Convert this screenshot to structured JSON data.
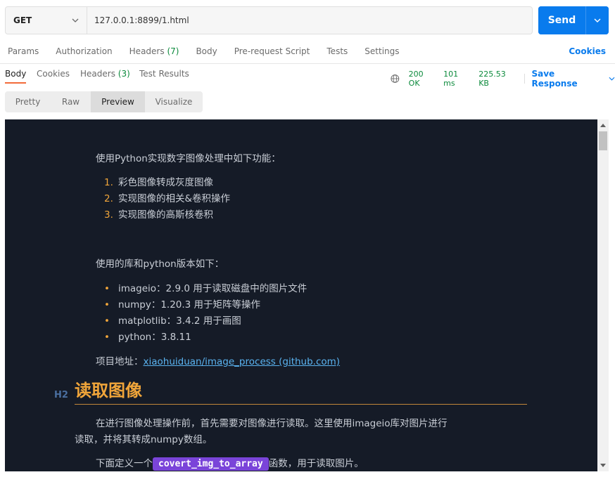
{
  "request": {
    "method": "GET",
    "url": "127.0.0.1:8899/1.html",
    "send_label": "Send"
  },
  "request_tabs": {
    "params": "Params",
    "authorization": "Authorization",
    "headers": "Headers",
    "headers_count": "(7)",
    "body": "Body",
    "prerequest": "Pre-request Script",
    "tests": "Tests",
    "settings": "Settings",
    "cookies": "Cookies"
  },
  "response_tabs": {
    "body": "Body",
    "cookies": "Cookies",
    "headers": "Headers",
    "headers_count": "(3)",
    "test_results": "Test Results"
  },
  "response_meta": {
    "status": "200 OK",
    "time": "101 ms",
    "size": "225.53 KB",
    "save_label": "Save Response"
  },
  "views": [
    "Pretty",
    "Raw",
    "Preview",
    "Visualize"
  ],
  "preview": {
    "intro": "使用Python实现数字图像处理中如下功能：",
    "features": [
      "彩色图像转成灰度图像",
      "实现图像的相关&卷积操作",
      "实现图像的高斯核卷积"
    ],
    "libs_intro": "使用的库和python版本如下：",
    "libs": [
      "imageio：2.9.0 用于读取磁盘中的图片文件",
      "numpy：1.20.3 用于矩阵等操作",
      "matplotlib：3.4.2 用于画图",
      "python：3.8.11"
    ],
    "project_label": "项目地址：",
    "project_link": "xiaohuiduan/image_process (github.com)",
    "h2_tag": "H2",
    "h2_title": "读取图像",
    "para1_line1": "在进行图像处理操作前，首先需要对图像进行读取。这里使用imageio库对图片进行",
    "para1_line2": "读取，并将其转成numpy数组。",
    "para2_before": "下面定义一个",
    "para2_code": "covert_img_to_array",
    "para2_after": "函数，用于读取图片。"
  },
  "colors": {
    "accent_blue": "#097bed",
    "status_green": "#0c8a3c",
    "preview_bg": "#151b27",
    "heading_orange": "#f0a53a",
    "code_purple": "#7a44d9"
  }
}
